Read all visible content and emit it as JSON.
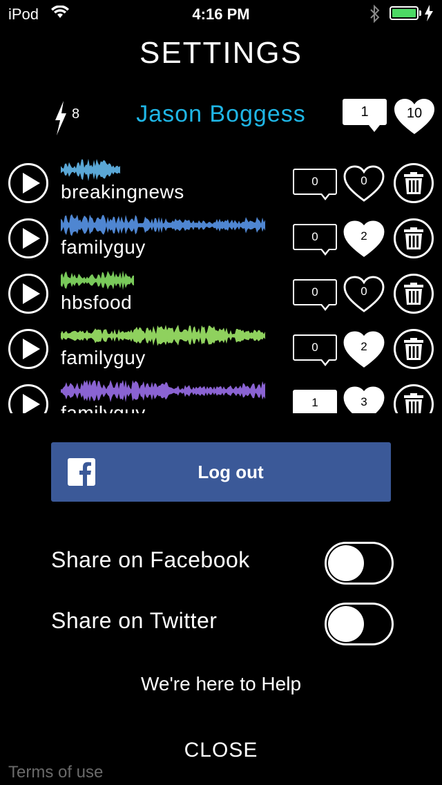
{
  "status_bar": {
    "carrier": "iPod",
    "time": "4:16 PM",
    "battery_color": "#4cd964"
  },
  "screen": {
    "title": "SETTINGS"
  },
  "user": {
    "name": "Jason Boggess",
    "name_color": "#1fb6e6",
    "power_count": "8",
    "comment_count": "1",
    "like_count": "10"
  },
  "tracks": [
    {
      "name": "breakingnews",
      "comments": "0",
      "likes": "0",
      "wave_color": "#5aa7d6",
      "liked": false,
      "commented": false
    },
    {
      "name": "familyguy",
      "comments": "0",
      "likes": "2",
      "wave_color": "#4f86d1",
      "liked": true,
      "commented": false
    },
    {
      "name": "hbsfood",
      "comments": "0",
      "likes": "0",
      "wave_color": "#79c95a",
      "liked": false,
      "commented": false
    },
    {
      "name": "familyguy",
      "comments": "0",
      "likes": "2",
      "wave_color": "#8fd15e",
      "liked": true,
      "commented": false
    },
    {
      "name": "familyguy",
      "comments": "1",
      "likes": "3",
      "wave_color": "#8a63d2",
      "liked": true,
      "commented": true
    }
  ],
  "facebook": {
    "button_label": "Log out",
    "color": "#3b5998"
  },
  "sharing": {
    "facebook_label": "Share on Facebook",
    "facebook_on": false,
    "twitter_label": "Share on Twitter",
    "twitter_on": false
  },
  "help_label": "We're here to Help",
  "close_label": "CLOSE",
  "terms_label": "Terms of use"
}
